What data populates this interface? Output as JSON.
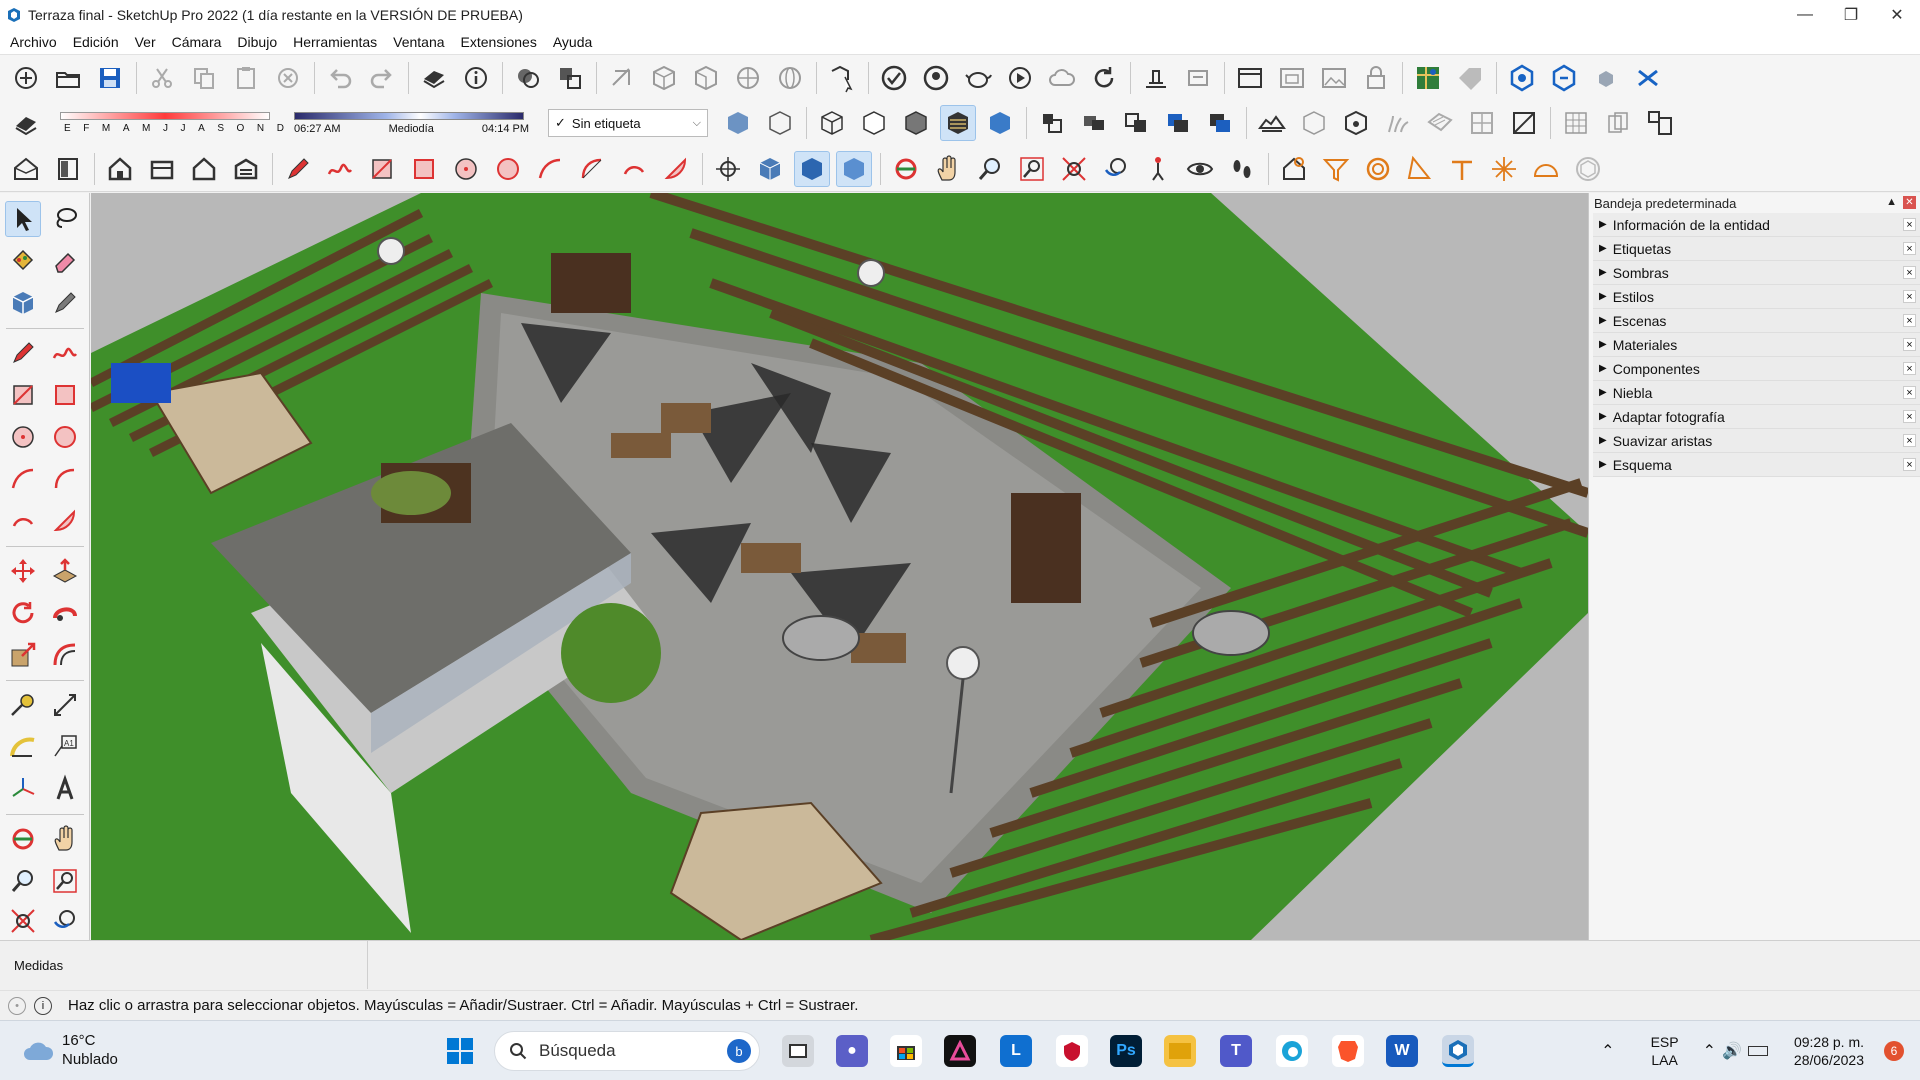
{
  "window": {
    "title": "Terraza final - SketchUp Pro 2022 (1 día restante en la VERSIÓN DE PRUEBA)",
    "controls": [
      "minimize",
      "restore",
      "close"
    ]
  },
  "menu": [
    "Archivo",
    "Edición",
    "Ver",
    "Cámara",
    "Dibujo",
    "Herramientas",
    "Ventana",
    "Extensiones",
    "Ayuda"
  ],
  "shadows": {
    "months": [
      "E",
      "F",
      "M",
      "A",
      "M",
      "J",
      "J",
      "A",
      "S",
      "O",
      "N",
      "D"
    ],
    "time_start": "06:27 AM",
    "time_mid": "Mediodía",
    "time_end": "04:14 PM"
  },
  "tag_selector": {
    "value": "Sin etiqueta"
  },
  "tray": {
    "title": "Bandeja predeterminada",
    "panels": [
      "Información de la entidad",
      "Etiquetas",
      "Sombras",
      "Estilos",
      "Escenas",
      "Materiales",
      "Componentes",
      "Niebla",
      "Adaptar fotografía",
      "Suavizar aristas",
      "Esquema"
    ]
  },
  "measurements_label": "Medidas",
  "status_text": "Haz clic o arrastra para seleccionar objetos. Mayúsculas = Añadir/Sustraer. Ctrl = Añadir. Mayúsculas + Ctrl = Sustraer.",
  "taskbar": {
    "temperature": "16°C",
    "weather": "Nublado",
    "search_placeholder": "Búsqueda",
    "language_line1": "ESP",
    "language_line2": "LAA",
    "time": "09:28 p. m.",
    "date": "28/06/2023",
    "notifications": "6"
  },
  "colors": {
    "grass": "#3f8f2a",
    "deck": "#8a8a86",
    "wood": "#5b4026",
    "accent": "#0078d4"
  }
}
